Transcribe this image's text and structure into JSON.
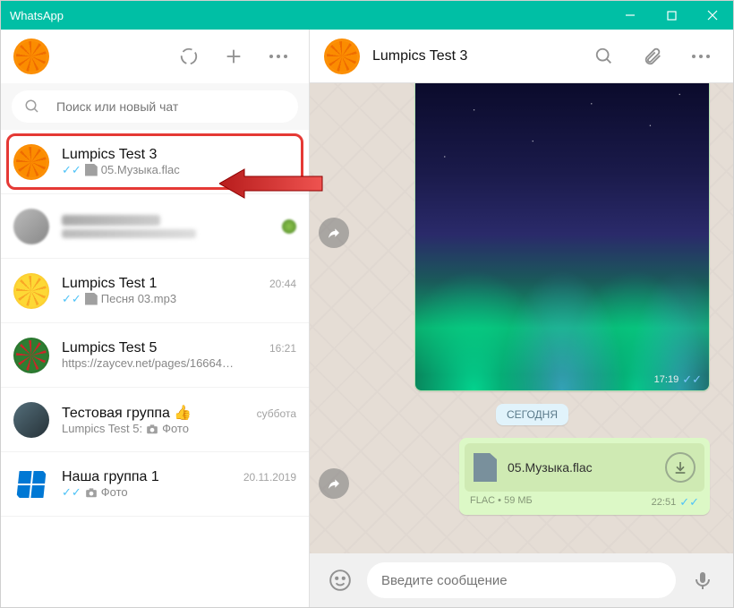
{
  "window_title": "WhatsApp",
  "search_placeholder": "Поиск или новый чат",
  "chats": [
    {
      "name": "Lumpics Test 3",
      "time": "",
      "preview": "05.Музыка.flac",
      "ticks": true,
      "doc": true,
      "highlight": true
    },
    {
      "name": "",
      "time": "",
      "preview": "",
      "blurred": true
    },
    {
      "name": "Lumpics Test 1",
      "time": "20:44",
      "preview": "Песня 03.mp3",
      "ticks": true,
      "doc": true
    },
    {
      "name": "Lumpics Test 5",
      "time": "16:21",
      "preview": "https://zaycev.net/pages/16664…"
    },
    {
      "name": "Тестовая группа 👍",
      "time": "суббота",
      "preview_prefix": "Lumpics Test 5:",
      "preview": "Фото",
      "camera": true
    },
    {
      "name": "Наша группа 1",
      "time": "20.11.2019",
      "preview": "Фото",
      "ticks": true,
      "camera": true
    }
  ],
  "chat_header_title": "Lumpics Test 3",
  "image_msg_time": "17:19",
  "day_label": "СЕГОДНЯ",
  "file_msg": {
    "name": "05.Музыка.flac",
    "type": "FLAC",
    "size": "59 МБ",
    "time": "22:51"
  },
  "composer_placeholder": "Введите сообщение"
}
